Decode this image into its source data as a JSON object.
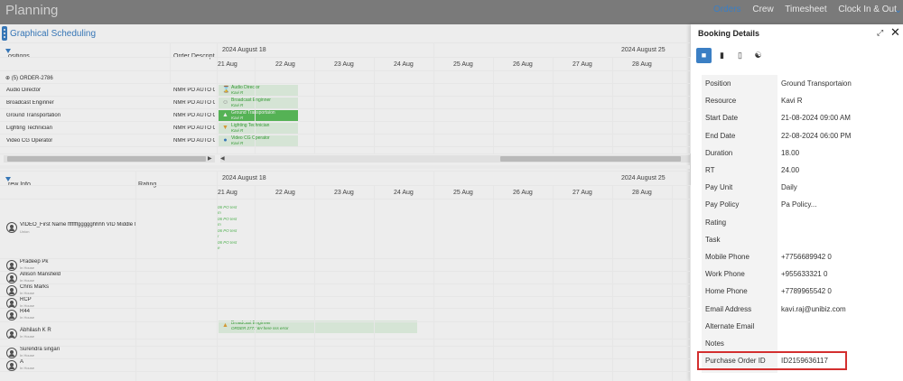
{
  "app": {
    "title": "Planning"
  },
  "topnav": [
    {
      "label": "Orders",
      "active": true
    },
    {
      "label": "Crew",
      "active": false
    },
    {
      "label": "Timesheet",
      "active": false
    },
    {
      "label": "Clock In & Out",
      "active": false
    }
  ],
  "schedule": {
    "title": "Graphical Scheduling",
    "top": {
      "col_positions": "ositions",
      "col_description": "Order Descriptio",
      "weeks": [
        "2024 August 18",
        "2024 August 25"
      ],
      "days": [
        "21 Aug",
        "22 Aug",
        "23 Aug",
        "24 Aug",
        "25 Aug",
        "26 Aug",
        "27 Aug",
        "28 Aug"
      ],
      "group": "(5) ORDER-2786",
      "rows": [
        {
          "position": "Audio Director",
          "description": "NMR PO AUTO CR",
          "booking": "Audio Director",
          "person": "Kavi R",
          "selected": false
        },
        {
          "position": "Broadcast Enginner",
          "description": "NMR PO AUTO CR",
          "booking": "Broadcast Enginner",
          "person": "Kavi R",
          "selected": false
        },
        {
          "position": "Ground Transportation",
          "description": "NMR PO AUTO CR",
          "booking": "Ground Transportaion",
          "person": "Kavi R",
          "selected": true
        },
        {
          "position": "Lighting Technician",
          "description": "NMR PO AUTO CR",
          "booking": "Lighting Technician",
          "person": "Kavi R",
          "selected": false
        },
        {
          "position": "Video CG Operator",
          "description": "NMR PO AUTO CR",
          "booking": "Video CG Operator",
          "person": "Kavi R",
          "selected": false
        }
      ]
    },
    "bottom": {
      "col_crew": "rew Info",
      "col_rating": "Rating",
      "weeks": [
        "2024 August 18",
        "2024 August 25"
      ],
      "days": [
        "21 Aug",
        "22 Aug",
        "23 Aug",
        "24 Aug",
        "25 Aug",
        "26 Aug",
        "27 Aug",
        "28 Aug"
      ],
      "crew": [
        {
          "name": "VIDEO_First Name fffffffggggghhhh VID Middle N",
          "sub": "Union"
        },
        {
          "name": "Pradeep Pk",
          "sub": "In House"
        },
        {
          "name": "Allison Mansfield",
          "sub": "In House"
        },
        {
          "name": "Chris Marks",
          "sub": "In House"
        },
        {
          "name": "RCP",
          "sub": "In House"
        },
        {
          "name": "R44",
          "sub": "In House"
        },
        {
          "name": "Abhilash K R",
          "sub": "In House"
        },
        {
          "name": "Surendra singari",
          "sub": "In House"
        },
        {
          "name": "A",
          "sub": "In House"
        }
      ],
      "po_notes": [
        "06 PO test",
        "m",
        "06 PO test",
        "m",
        "06 PO test",
        "r",
        "06 PO test",
        "e"
      ],
      "booking": {
        "label": "Broadcast Enginner",
        "sub": "ORDER 2777 6H here sss error"
      }
    }
  },
  "panel": {
    "title": "Booking Details",
    "tabs": [
      "details",
      "chat",
      "mobile",
      "cart"
    ],
    "fields": [
      {
        "label": "Position",
        "value": "Ground Transportaion"
      },
      {
        "label": "Resource",
        "value": "Kavi R"
      },
      {
        "label": "Start Date",
        "value": "21-08-2024 09:00 AM"
      },
      {
        "label": "End Date",
        "value": "22-08-2024 06:00 PM"
      },
      {
        "label": "Duration",
        "value": "18.00"
      },
      {
        "label": "RT",
        "value": "24.00"
      },
      {
        "label": "Pay Unit",
        "value": "Daily"
      },
      {
        "label": "Pay Policy",
        "value": "Pa Policy..."
      },
      {
        "label": "Rating",
        "value": ""
      },
      {
        "label": "Task",
        "value": ""
      },
      {
        "label": "Mobile Phone",
        "value": "+7756689942 0"
      },
      {
        "label": "Work Phone",
        "value": "+955633321 0"
      },
      {
        "label": "Home Phone",
        "value": "+7789965542 0"
      },
      {
        "label": "Email Address",
        "value": "kavi.raj@unibiz.com"
      },
      {
        "label": "Alternate Email",
        "value": ""
      },
      {
        "label": "Notes",
        "value": ""
      },
      {
        "label": "Purchase Order ID",
        "value": "ID2159636117"
      }
    ],
    "accent": "#3b7fc4",
    "highlight_color": "#d32f2f"
  }
}
